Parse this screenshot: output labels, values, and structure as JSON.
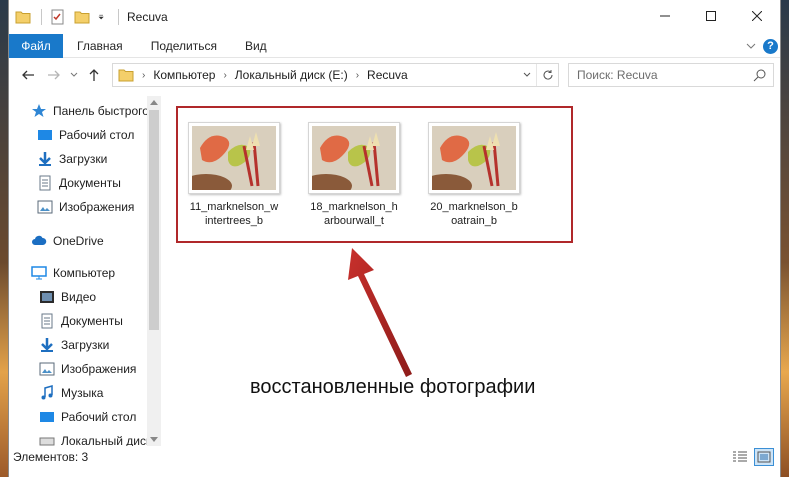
{
  "window": {
    "title": "Recuva"
  },
  "ribbon": {
    "file_tab": "Файл",
    "tabs": [
      "Главная",
      "Поделиться",
      "Вид"
    ],
    "help": "?"
  },
  "address": {
    "crumbs": [
      "Компьютер",
      "Локальный диск (E:)",
      "Recuva"
    ]
  },
  "search": {
    "placeholder": "Поиск: Recuva"
  },
  "nav": {
    "items": [
      {
        "label": "Панель быстрого доступа",
        "icon": "star-icon",
        "pinned": false
      },
      {
        "label": "Рабочий стол",
        "icon": "desktop-icon",
        "pinned": true
      },
      {
        "label": "Загрузки",
        "icon": "download-icon",
        "pinned": true
      },
      {
        "label": "Документы",
        "icon": "document-icon",
        "pinned": true
      },
      {
        "label": "Изображения",
        "icon": "picture-icon",
        "pinned": true
      },
      {
        "label": "OneDrive",
        "icon": "cloud-icon",
        "pinned": false
      },
      {
        "label": "Компьютер",
        "icon": "computer-icon",
        "pinned": false
      },
      {
        "label": "Видео",
        "icon": "video-icon",
        "pinned": false
      },
      {
        "label": "Документы",
        "icon": "document-icon",
        "pinned": false
      },
      {
        "label": "Загрузки",
        "icon": "download-icon",
        "pinned": false
      },
      {
        "label": "Изображения",
        "icon": "picture-icon",
        "pinned": false
      },
      {
        "label": "Музыка",
        "icon": "music-icon",
        "pinned": false
      },
      {
        "label": "Рабочий стол",
        "icon": "desktop-icon",
        "pinned": false
      },
      {
        "label": "Локальный диск",
        "icon": "drive-icon",
        "pinned": false
      }
    ]
  },
  "files": [
    {
      "name_line1": "11_marknelson_w",
      "name_line2": "intertrees_b"
    },
    {
      "name_line1": "18_marknelson_h",
      "name_line2": "arbourwall_t"
    },
    {
      "name_line1": "20_marknelson_b",
      "name_line2": "oatrain_b"
    }
  ],
  "annotation": {
    "text": "восстановленные фотографии",
    "color": "#b0282a"
  },
  "status": {
    "items_count": "Элементов: 3"
  },
  "colors": {
    "file_tab": "#1979ca",
    "highlight": "#b0282a"
  }
}
